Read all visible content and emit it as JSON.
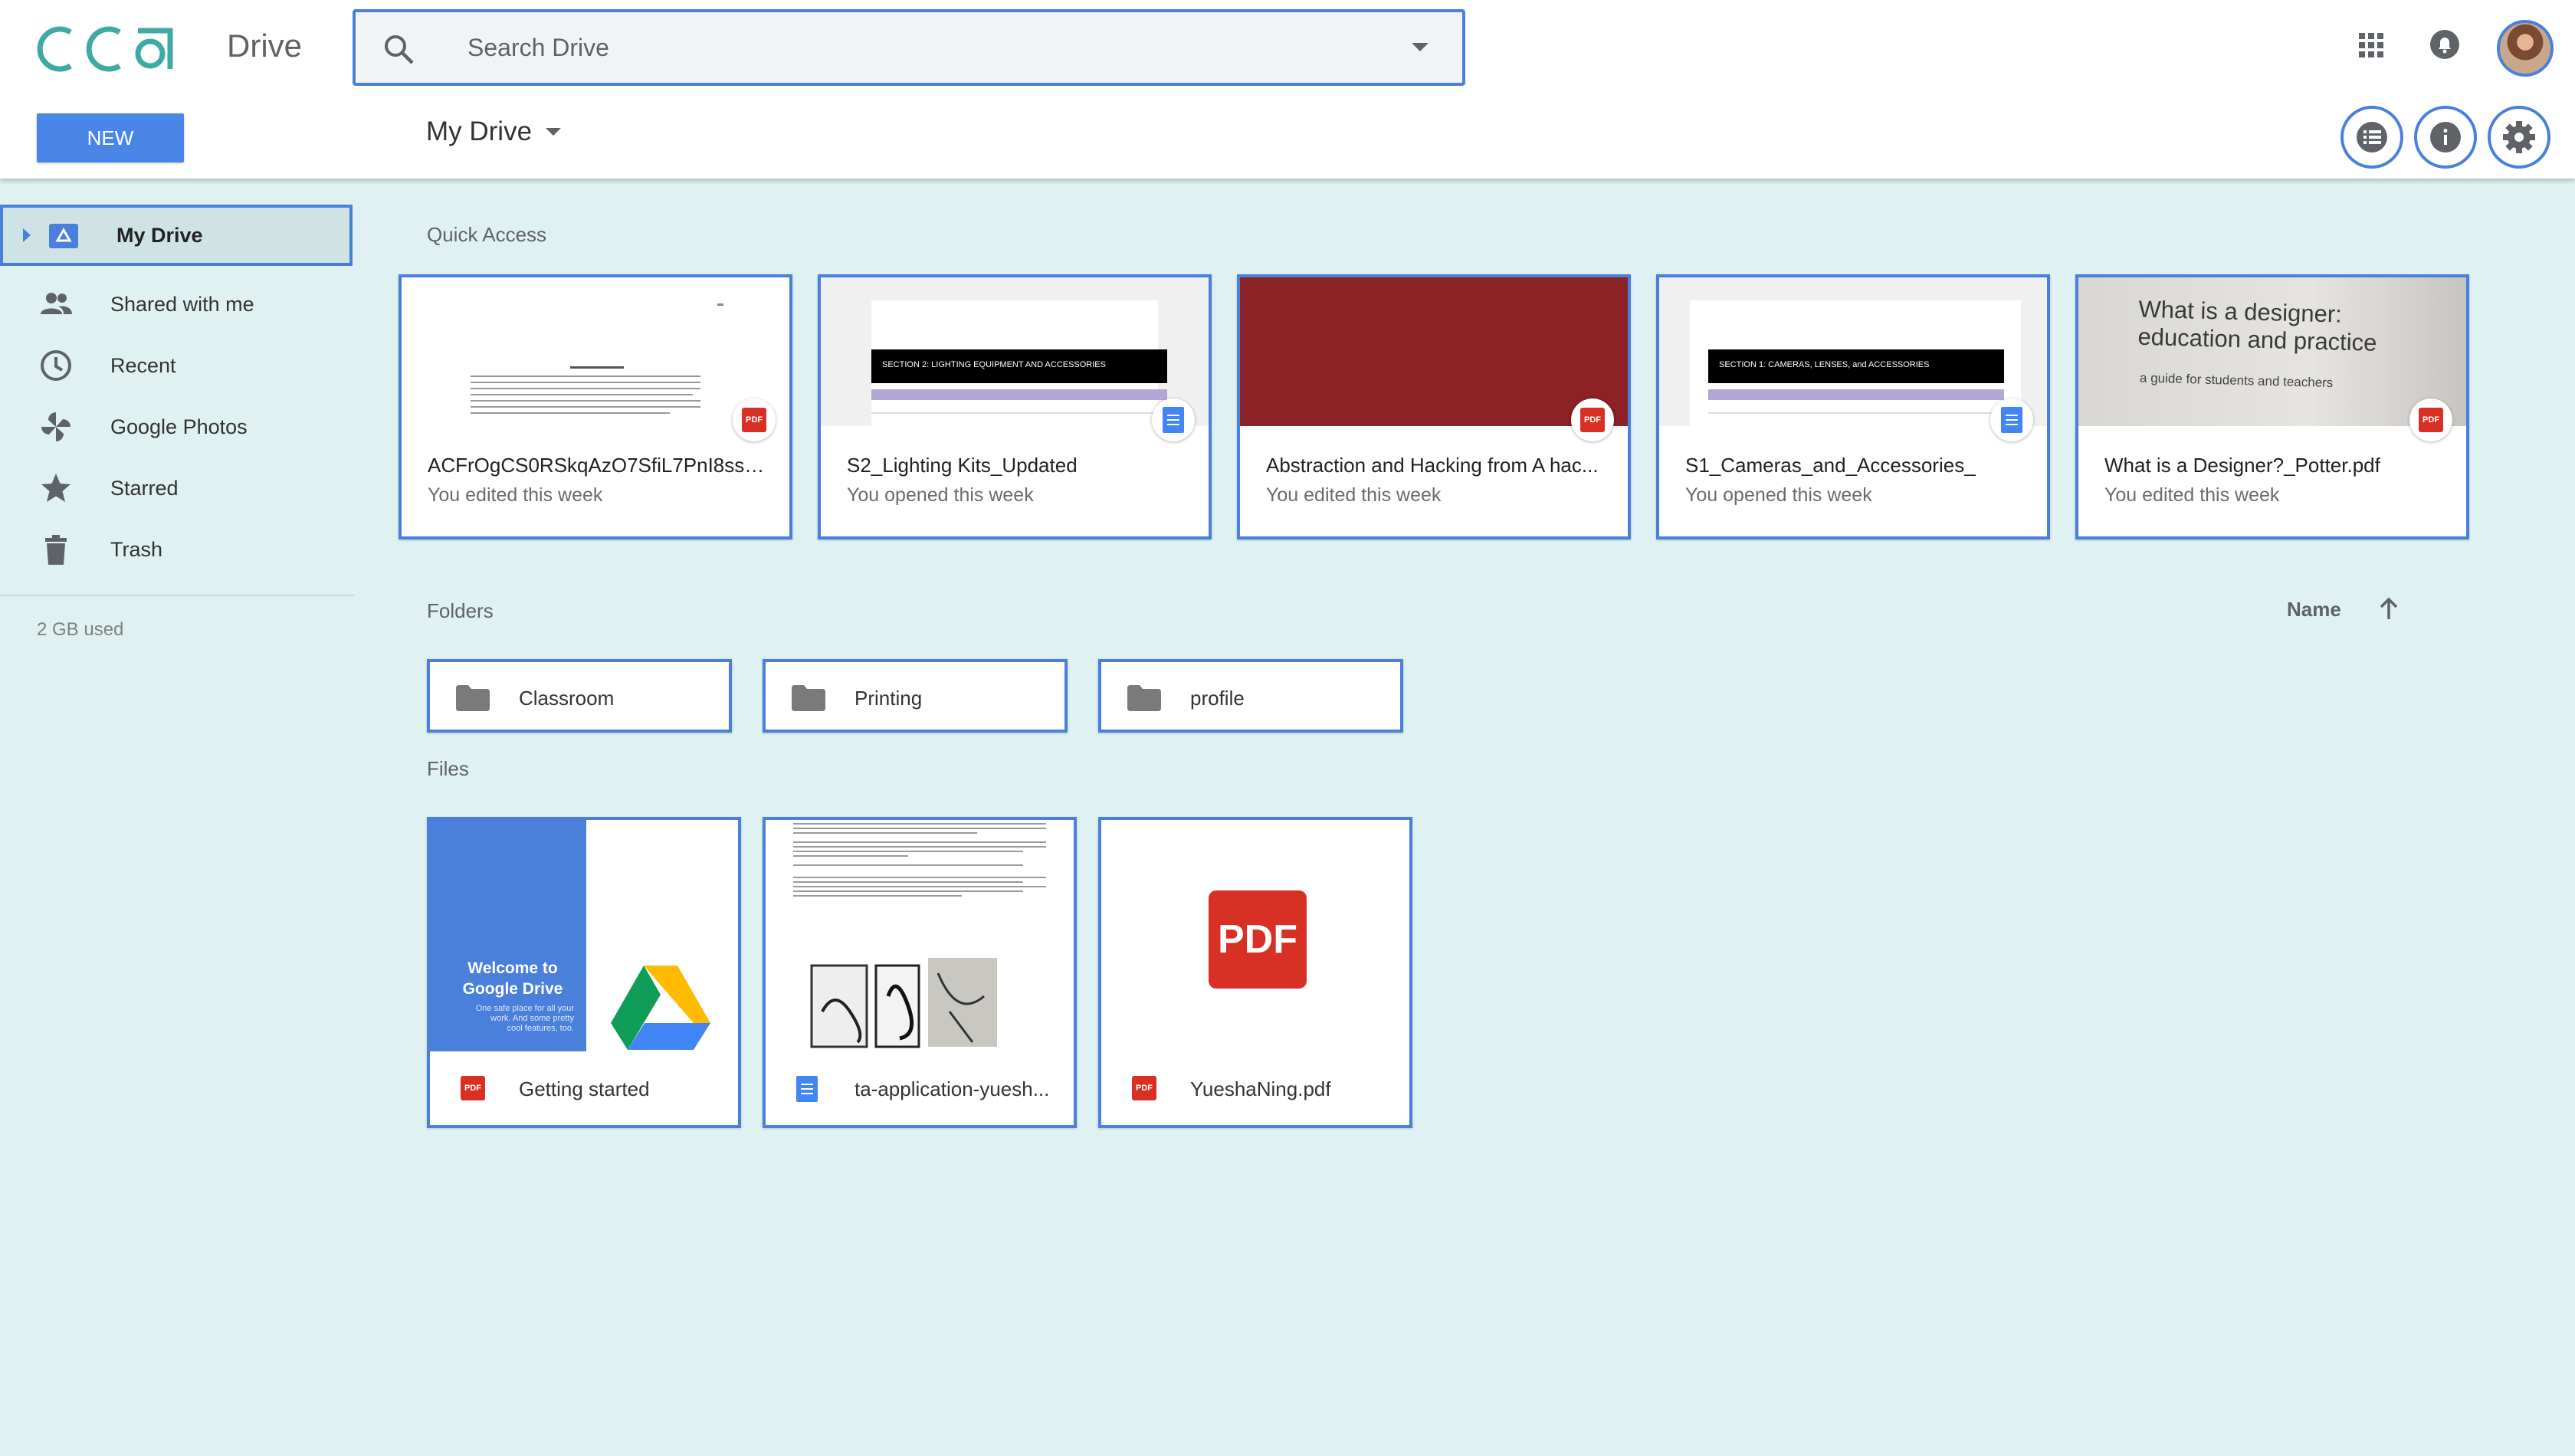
{
  "header": {
    "logo_text": "CCA",
    "app_name": "Drive",
    "search_placeholder": "Search Drive",
    "icons": [
      "search-icon",
      "dropdown-caret-icon",
      "apps-grid-icon",
      "notifications-bell-icon",
      "avatar"
    ],
    "accent": "#4a7fdc"
  },
  "toolbar": {
    "new_label": "NEW",
    "title": "My Drive",
    "icons": [
      "list-view-icon",
      "info-icon",
      "settings-icon"
    ]
  },
  "sidebar": {
    "items": [
      {
        "label": "My Drive",
        "icon": "my-drive-icon",
        "active": true
      },
      {
        "label": "Shared with me",
        "icon": "people-icon"
      },
      {
        "label": "Recent",
        "icon": "clock-icon"
      },
      {
        "label": "Google Photos",
        "icon": "pinwheel-icon"
      },
      {
        "label": "Starred",
        "icon": "star-icon"
      },
      {
        "label": "Trash",
        "icon": "trash-icon"
      }
    ],
    "storage": "2 GB used"
  },
  "quick_access": {
    "label": "Quick Access",
    "cards": [
      {
        "name": "ACFrOgCS0RSkqAzO7SfiL7PnI8ssht...",
        "sub": "You edited this week",
        "type": "pdf"
      },
      {
        "name": "S2_Lighting Kits_Updated",
        "sub": "You opened this week",
        "type": "doc",
        "thumb_heading": "SECTION 2: LIGHTING EQUIPMENT AND ACCESSORIES"
      },
      {
        "name": "Abstraction and Hacking from A hac...",
        "sub": "You edited this week",
        "type": "pdf"
      },
      {
        "name": "S1_Cameras_and_Accessories_",
        "sub": "You opened this week",
        "type": "doc",
        "thumb_heading": "SECTION 1: CAMERAS, LENSES, and ACCESSORIES"
      },
      {
        "name": "What is a Designer?_Potter.pdf",
        "sub": "You edited this week",
        "type": "pdf",
        "thumb_title": "What is a designer: education and practice",
        "thumb_subtitle": "a guide for students and teachers"
      }
    ]
  },
  "folders": {
    "label": "Folders",
    "sort_label": "Name",
    "items": [
      "Classroom",
      "Printing",
      "profile"
    ]
  },
  "files": {
    "label": "Files",
    "items": [
      {
        "name": "Getting started",
        "type": "pdf",
        "thumb_title": "Welcome to Google Drive",
        "thumb_body": "One safe place for all your work. And some pretty cool features, too."
      },
      {
        "name": "ta-application-yuesh...",
        "type": "doc"
      },
      {
        "name": "YueshaNing.pdf",
        "type": "pdf",
        "thumb_text": "PDF"
      }
    ]
  }
}
